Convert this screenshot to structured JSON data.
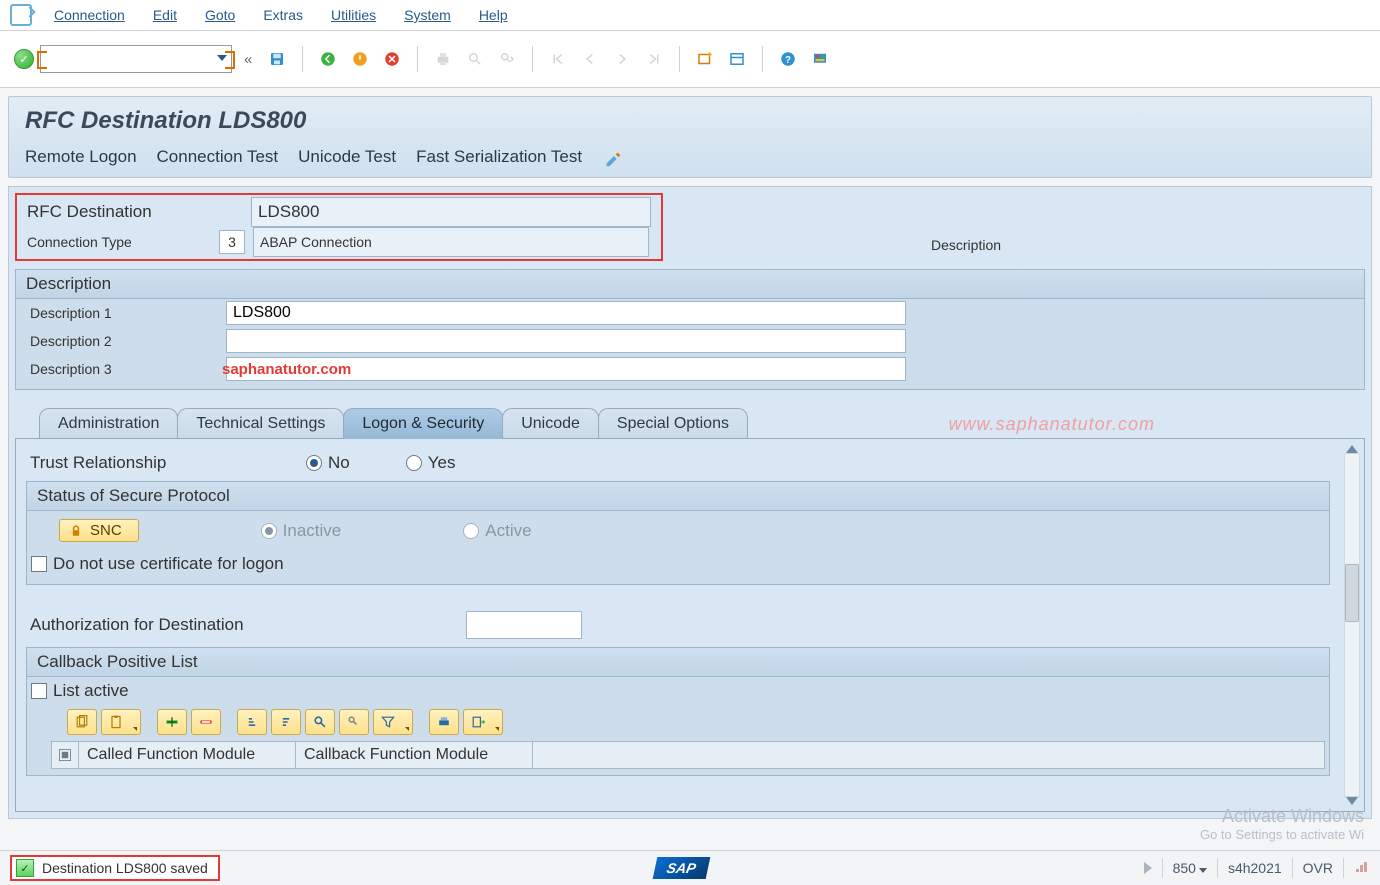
{
  "menu": {
    "items": [
      "Connection",
      "Edit",
      "Goto",
      "Extras",
      "Utilities",
      "System",
      "Help"
    ],
    "acc_index": [
      0,
      0,
      0,
      1,
      0,
      0,
      0
    ]
  },
  "toolbar": {
    "command": "",
    "icons": [
      "save",
      "back",
      "exit",
      "cancel",
      "print",
      "find",
      "find-next",
      "first",
      "prev",
      "next",
      "last",
      "new-session",
      "layout",
      "help",
      "gui-options"
    ]
  },
  "page": {
    "title": "RFC Destination LDS800",
    "actions": [
      "Remote Logon",
      "Connection Test",
      "Unicode Test",
      "Fast Serialization Test"
    ]
  },
  "header": {
    "rfc_label": "RFC Destination",
    "rfc_value": "LDS800",
    "conn_type_label": "Connection Type",
    "conn_type_code": "3",
    "conn_type_text": "ABAP Connection",
    "desc_side_label": "Description"
  },
  "description": {
    "group_title": "Description",
    "rows": [
      {
        "label": "Description 1",
        "value": "LDS800"
      },
      {
        "label": "Description 2",
        "value": ""
      },
      {
        "label": "Description 3",
        "value": ""
      }
    ],
    "watermark_row3": "saphanatutor.com"
  },
  "tabs": {
    "items": [
      "Administration",
      "Technical Settings",
      "Logon & Security",
      "Unicode",
      "Special Options"
    ],
    "active_index": 2,
    "watermark": "www.saphanatutor.com"
  },
  "logon_security": {
    "trust_label": "Trust Relationship",
    "trust_options": [
      "No",
      "Yes"
    ],
    "trust_selected": 0,
    "secure_title": "Status of Secure Protocol",
    "snc_btn": "SNC",
    "snc_options": [
      "Inactive",
      "Active"
    ],
    "snc_selected": 0,
    "cert_checkbox": "Do not use certificate for logon",
    "auth_label": "Authorization for Destination",
    "auth_value": "",
    "callback_title": "Callback Positive List",
    "list_active_label": "List active",
    "tbl_cols": [
      "Called Function Module",
      "Callback Function Module"
    ]
  },
  "status": {
    "message": "Destination LDS800 saved",
    "client": "850",
    "system": "s4h2021",
    "mode": "OVR"
  },
  "overlay": {
    "line1": "Activate Windows",
    "line2": "Go to Settings to activate Wi"
  }
}
